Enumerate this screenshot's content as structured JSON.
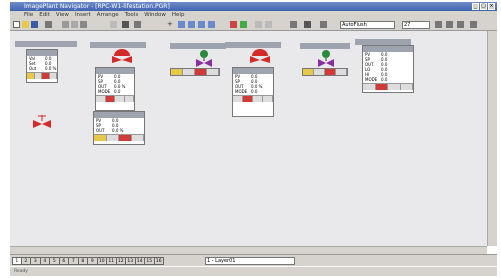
{
  "window": {
    "title": "ImagePlant Navigator - [RPC-W1-lifestation.PGR]"
  },
  "menu": [
    "File",
    "Edit",
    "View",
    "Insert",
    "Arrange",
    "Tools",
    "Window",
    "Help"
  ],
  "toolbar": {
    "zoom_value": "AutoFlush",
    "value_field": "27"
  },
  "status": {
    "text": "Ready"
  },
  "sheet_tabs": [
    "1",
    "2",
    "3",
    "4",
    "5",
    "6",
    "7",
    "8",
    "9",
    "10",
    "11",
    "12",
    "13",
    "14",
    "15",
    "16"
  ],
  "selected_tab_index": 0,
  "layer_field": "1 - Layer01",
  "panels": [
    {
      "rows": [
        {
          "l": "Val",
          "v": "0.0"
        },
        {
          "l": "Set",
          "v": "0.0"
        },
        {
          "l": "Out",
          "v": "0.0 %"
        }
      ]
    },
    {
      "rows": [
        {
          "l": "PV",
          "v": "0.0"
        },
        {
          "l": "SP",
          "v": "0.0"
        },
        {
          "l": "OUT",
          "v": "0.0 %"
        },
        {
          "l": "MODE",
          "v": "0.0"
        }
      ]
    },
    {
      "rows": [
        {
          "l": "PV",
          "v": "0.0"
        },
        {
          "l": "SP",
          "v": "0.0"
        },
        {
          "l": "OUT",
          "v": "0.0 %"
        },
        {
          "l": "MODE",
          "v": "0.0"
        }
      ]
    },
    {
      "rows": [
        {
          "l": "PV",
          "v": "0.0"
        },
        {
          "l": "SP",
          "v": "0.0"
        },
        {
          "l": "OUT",
          "v": "0.0"
        },
        {
          "l": "LO",
          "v": "0.0"
        },
        {
          "l": "HI",
          "v": "0.0"
        },
        {
          "l": "MODE",
          "v": "0.0"
        }
      ]
    },
    {
      "rows": [
        {
          "l": "PV",
          "v": "0.0"
        },
        {
          "l": "SP",
          "v": "0.0"
        },
        {
          "l": "OUT",
          "v": "0.0 %"
        }
      ]
    }
  ],
  "colors": {
    "valve_red": "#d42a2a",
    "valve_purple": "#8a2ea0",
    "valve_green": "#2a8a3a",
    "canvas_bg": "#e9e8ea"
  }
}
